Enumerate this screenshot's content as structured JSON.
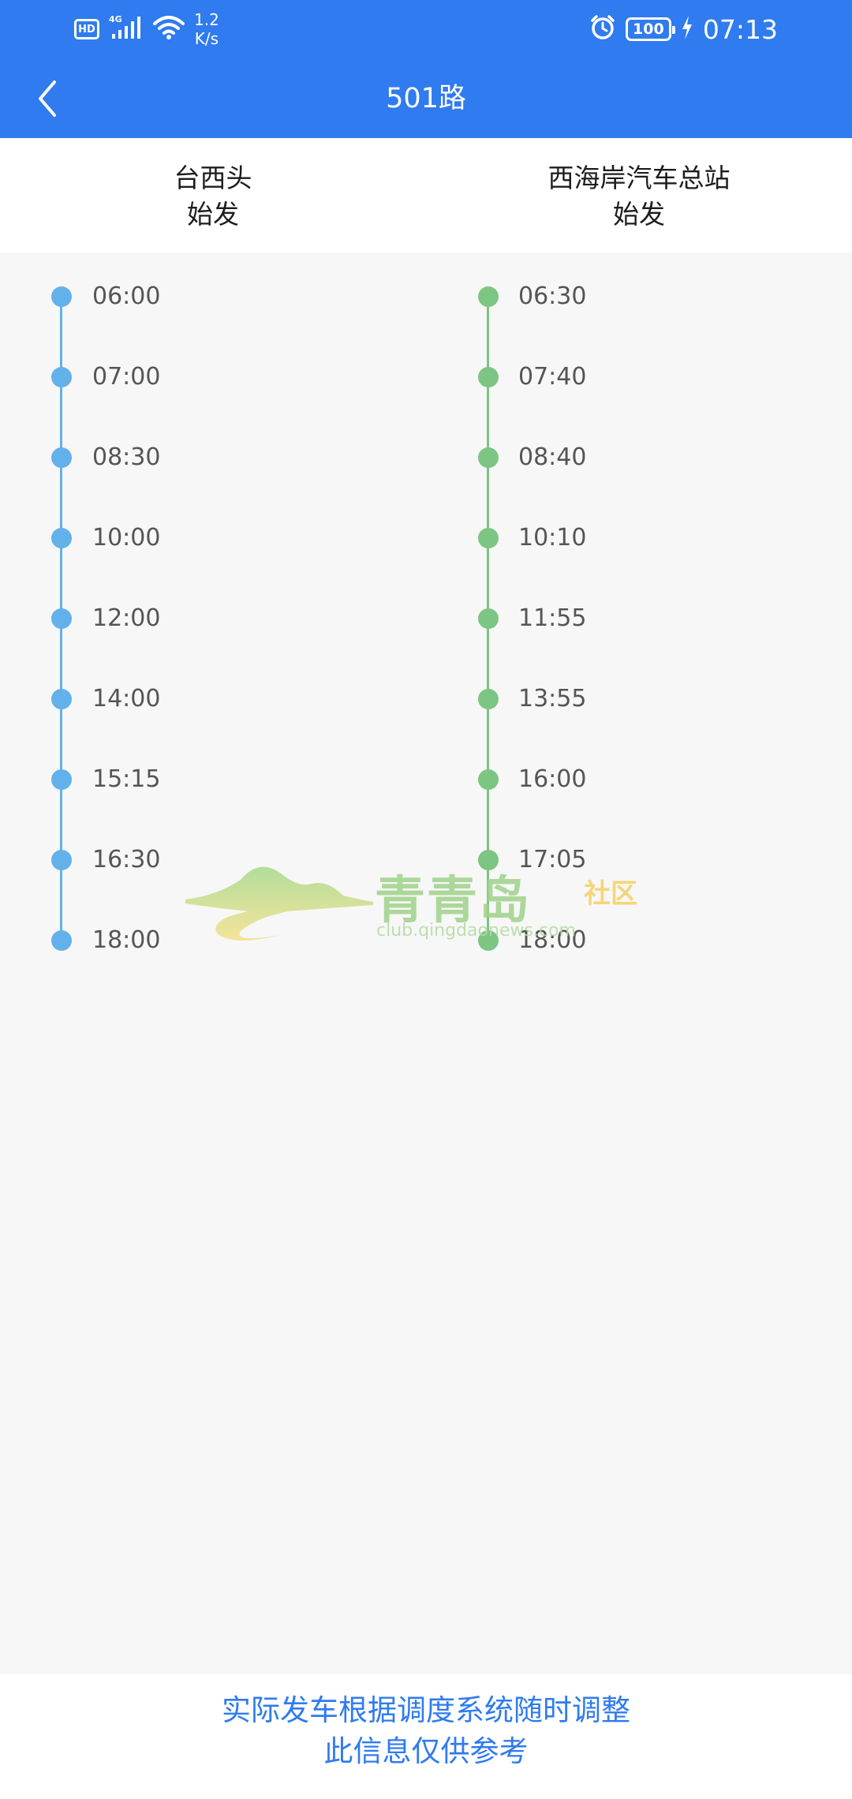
{
  "status_bar": {
    "hd": "HD",
    "network": "4G",
    "speed_value": "1.2",
    "speed_unit": "K/s",
    "battery": "100",
    "time": "07:13"
  },
  "titlebar": {
    "title": "501路"
  },
  "columns": [
    {
      "station": "台西头",
      "label": "始发",
      "color": "#63b1ea",
      "times": [
        "06:00",
        "07:00",
        "08:30",
        "10:00",
        "12:00",
        "14:00",
        "15:15",
        "16:30",
        "18:00"
      ]
    },
    {
      "station": "西海岸汽车总站",
      "label": "始发",
      "color": "#7cc583",
      "times": [
        "06:30",
        "07:40",
        "08:40",
        "10:10",
        "11:55",
        "13:55",
        "16:00",
        "17:05",
        "18:00"
      ]
    }
  ],
  "watermark": {
    "brand": "青青岛",
    "suffix": "社区",
    "url": "club.qingdaonews.com"
  },
  "footer": {
    "line1": "实际发车根据调度系统随时调整",
    "line2": "此信息仅供参考"
  }
}
